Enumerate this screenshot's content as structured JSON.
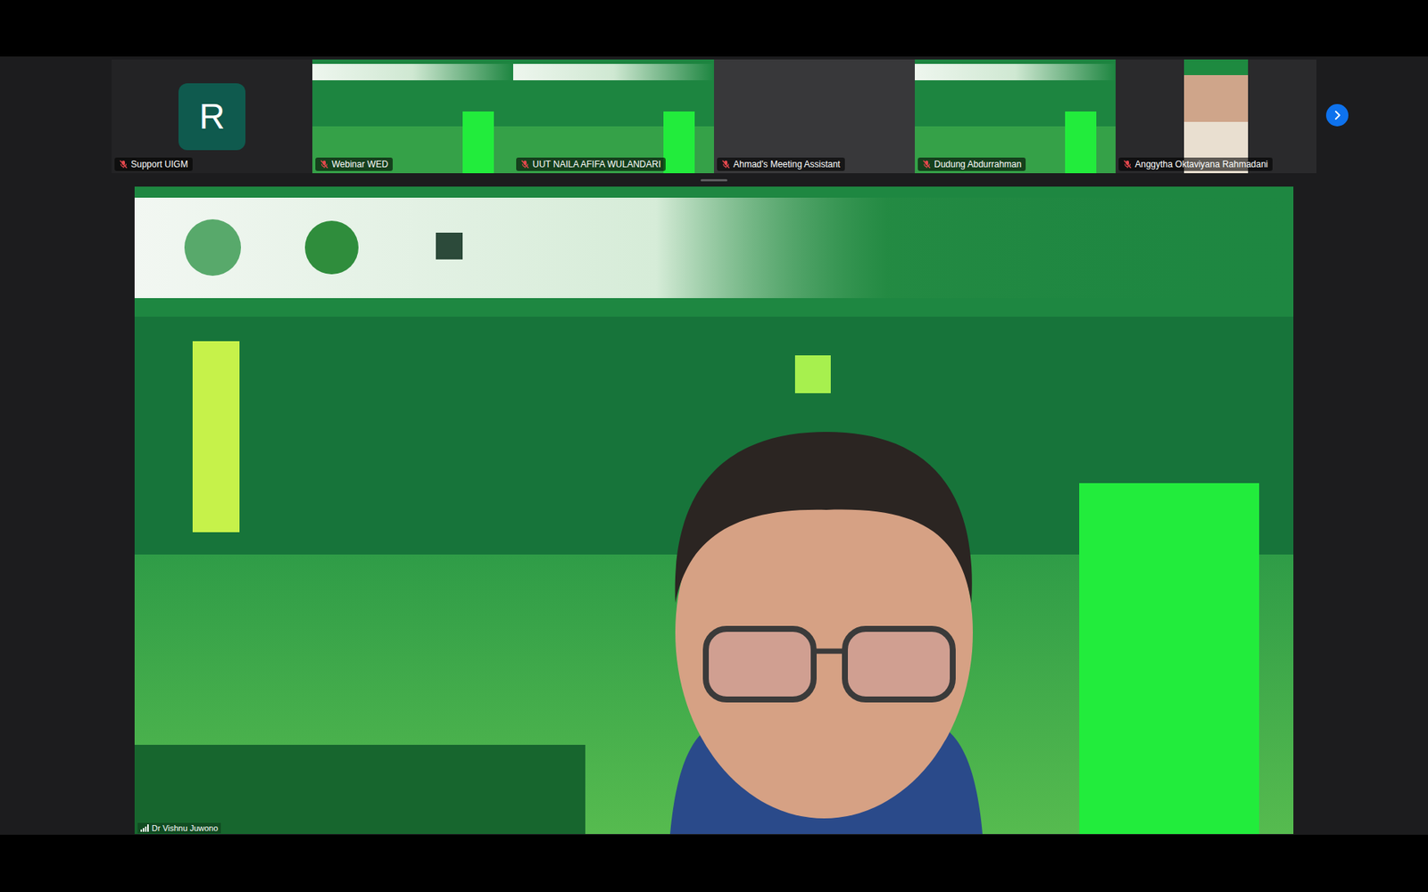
{
  "gallery": {
    "participants": [
      {
        "name": "Support UIGM",
        "kind": "avatar",
        "initial": "R",
        "muted": true
      },
      {
        "name": "Webinar WED",
        "kind": "slide",
        "muted": true
      },
      {
        "name": "UUT NAILA AFIFA WULANDARI",
        "kind": "slide",
        "muted": true
      },
      {
        "name": "Ahmad's Meeting Assistant",
        "kind": "dark",
        "muted": true
      },
      {
        "name": "Dudung Abdurrahman",
        "kind": "slide",
        "muted": true
      },
      {
        "name": "Anggytha Oktaviyana Rahmadani",
        "kind": "camera",
        "muted": true
      }
    ]
  },
  "speaker": {
    "name": "Dr Vishnu Juwono",
    "muted": false
  }
}
